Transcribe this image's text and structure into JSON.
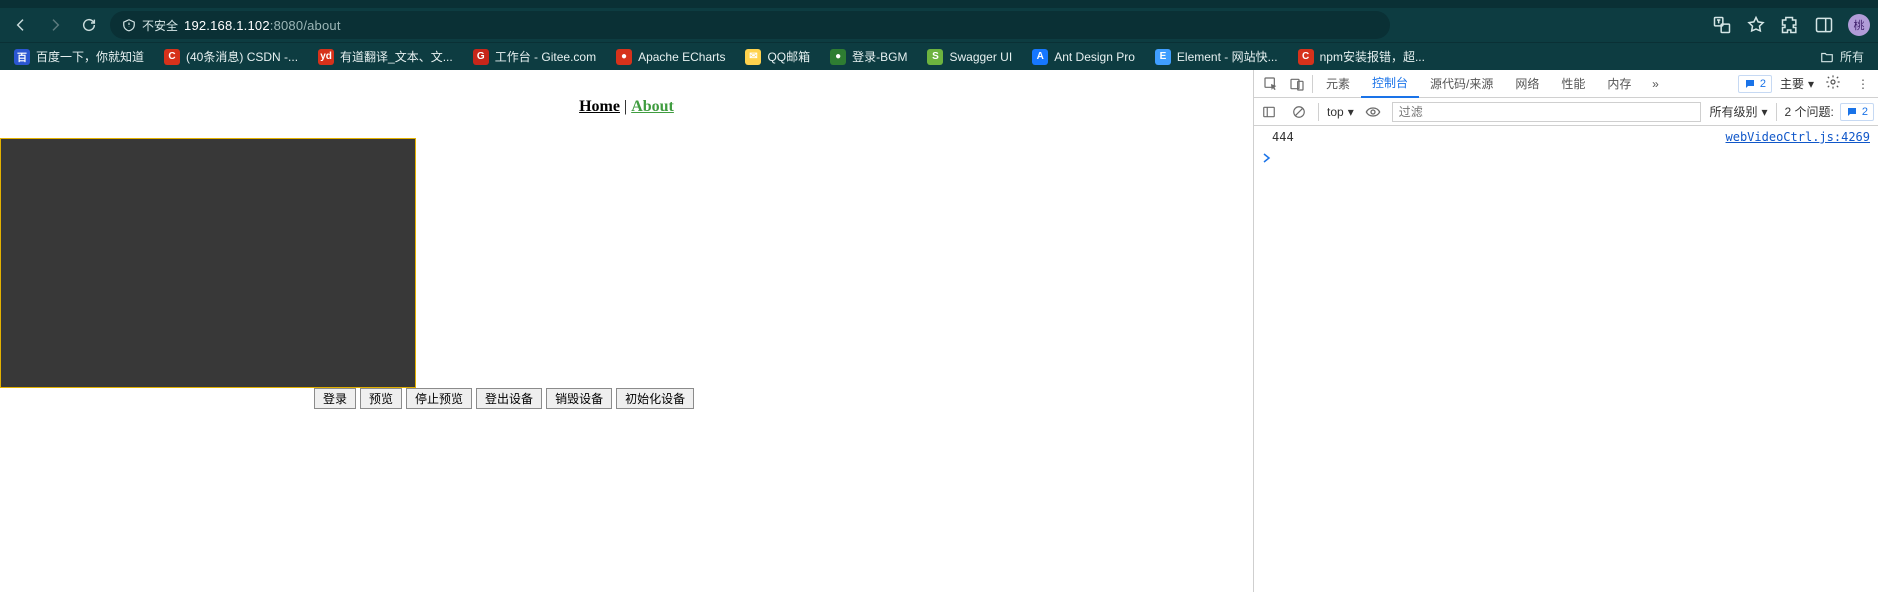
{
  "browser": {
    "insecure_label": "不安全",
    "url_host": "192.168.1.102",
    "url_port": ":8080",
    "url_path": "/about",
    "avatar_initial": "桃",
    "all_bookmarks_label": "所有"
  },
  "bookmarks": [
    {
      "label": "百度一下，你就知道",
      "icon_bg": "#2b56d2",
      "icon_text": "百"
    },
    {
      "label": "(40条消息) CSDN -...",
      "icon_bg": "#d6321b",
      "icon_text": "C"
    },
    {
      "label": "有道翻译_文本、文...",
      "icon_bg": "#d6321b",
      "icon_text": "yd"
    },
    {
      "label": "工作台 - Gitee.com",
      "icon_bg": "#c7261a",
      "icon_text": "G"
    },
    {
      "label": "Apache ECharts",
      "icon_bg": "#d6321b",
      "icon_text": "●"
    },
    {
      "label": "QQ邮箱",
      "icon_bg": "#ffd24d",
      "icon_text": "✉"
    },
    {
      "label": "登录-BGM",
      "icon_bg": "#2e7d32",
      "icon_text": "●"
    },
    {
      "label": "Swagger UI",
      "icon_bg": "#6db33f",
      "icon_text": "S"
    },
    {
      "label": "Ant Design Pro",
      "icon_bg": "#1677ff",
      "icon_text": "A"
    },
    {
      "label": "Element - 网站快...",
      "icon_bg": "#409eff",
      "icon_text": "E"
    },
    {
      "label": "npm安装报错，超...",
      "icon_bg": "#d6321b",
      "icon_text": "C"
    }
  ],
  "page": {
    "nav_home": "Home",
    "nav_sep": " | ",
    "nav_about": "About",
    "buttons": [
      "登录",
      "预览",
      "停止预览",
      "登出设备",
      "销毁设备",
      "初始化设备"
    ]
  },
  "devtools": {
    "tabs": [
      "元素",
      "控制台",
      "源代码/来源",
      "网络",
      "性能",
      "内存"
    ],
    "active_tab_index": 1,
    "overflow_glyph": "»",
    "msg_count": "2",
    "main_dropdown": "主要",
    "context": "top",
    "filter_placeholder": "过滤",
    "levels_label": "所有级别",
    "issues_label": "2 个问题:",
    "issues_count": "2",
    "console_lines": [
      {
        "msg": "444",
        "src": "webVideoCtrl.js:4269"
      }
    ]
  }
}
